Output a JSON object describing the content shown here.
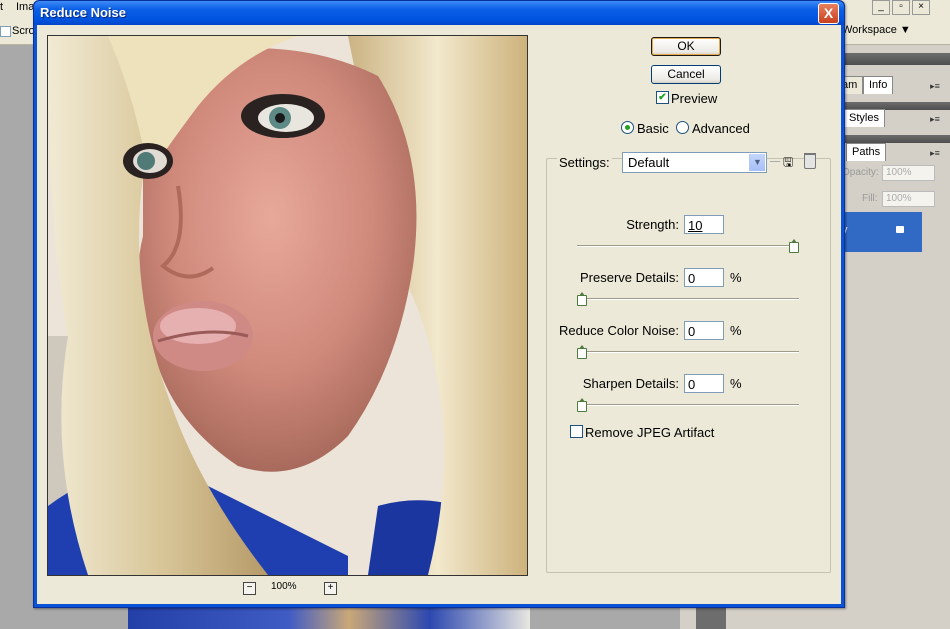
{
  "app": {
    "menubar_items": [
      "t",
      "Ima"
    ],
    "options_scroll_label": "Scrol",
    "workspace_label": "Workspace ▼",
    "panels": {
      "tabs_top": [
        "am",
        "Info"
      ],
      "tabs_mid": [
        "Styles"
      ],
      "tabs_layers": [
        "Paths"
      ],
      "opacity_label": "Opacity:",
      "opacity_value": "100%",
      "fill_label": "Fill:",
      "fill_value": "100%",
      "layer_letter": "y"
    }
  },
  "dialog": {
    "title": "Reduce Noise",
    "close_label": "X",
    "ok_label": "OK",
    "cancel_label": "Cancel",
    "preview_label": "Preview",
    "preview_checked": true,
    "mode_options": [
      "Basic",
      "Advanced"
    ],
    "mode_selected": "Basic",
    "settings_label": "Settings:",
    "settings_value": "Default",
    "zoom_value": "100%",
    "zoom_out_label": "−",
    "zoom_in_label": "+",
    "controls": [
      {
        "label": "Strength:",
        "value": "10",
        "unit": "",
        "level": 1.0
      },
      {
        "label": "Preserve Details:",
        "value": "0",
        "unit": "%",
        "level": 0.0
      },
      {
        "label": "Reduce Color Noise:",
        "value": "0",
        "unit": "%",
        "level": 0.0
      },
      {
        "label": "Sharpen Details:",
        "value": "0",
        "unit": "%",
        "level": 0.0
      }
    ],
    "jpeg_artifact_label": "Remove JPEG Artifact",
    "jpeg_artifact_checked": false
  },
  "colors": {
    "title_bar": "#0a52d6",
    "dialog_face": "#ece9d8",
    "check_green": "#21a121",
    "selection_blue": "#316ac5"
  },
  "icons": {
    "save_settings": "save-preset-icon",
    "delete_settings": "trash-icon",
    "close": "close-icon",
    "dropdown": "chevron-down-icon"
  }
}
